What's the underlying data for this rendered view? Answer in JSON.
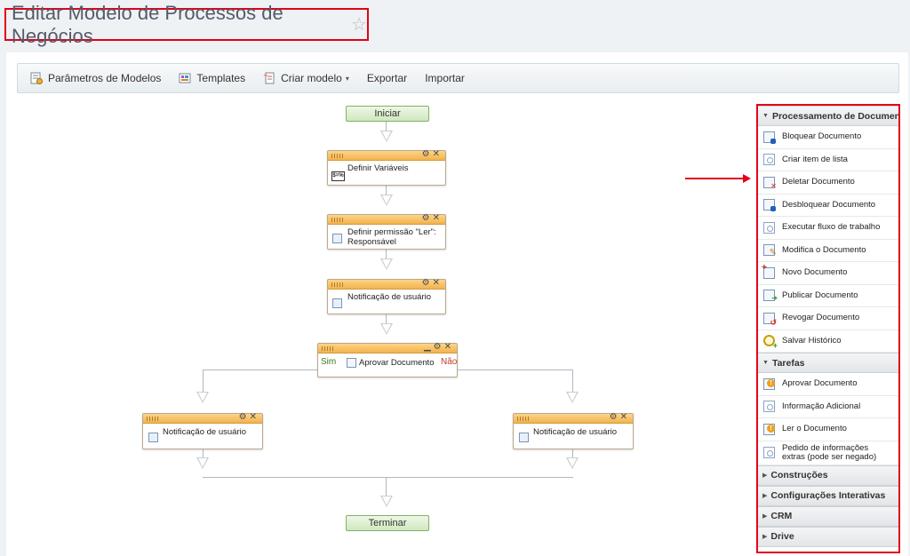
{
  "page": {
    "title": "Editar Modelo de Processos de Negócios",
    "favorite_icon": "star-icon"
  },
  "toolbar": {
    "items": [
      {
        "label": "Parâmetros de Modelos",
        "icon": "settings-icon"
      },
      {
        "label": "Templates",
        "icon": "templates-icon"
      },
      {
        "label": "Criar modelo",
        "icon": "create-model-icon"
      },
      {
        "label": "Exportar"
      },
      {
        "label": "Importar"
      }
    ]
  },
  "diagram": {
    "start_label": "Iniciar",
    "end_label": "Terminar",
    "nodes": {
      "set_variables": "Definir Variáveis",
      "set_variables_icon_text": "$=%",
      "set_permission": "Definir permissão \"Ler\": Responsável",
      "user_notification": "Notificação de usuário",
      "approve_document": "Aprovar Documento",
      "left_notification": "Notificação de usuário",
      "right_notification": "Notificação de usuário"
    },
    "branch_yes": "Sim",
    "branch_no": "Não"
  },
  "panel": {
    "sections": [
      {
        "title": "Processamento de Document",
        "expanded": true,
        "items": [
          {
            "label": "Bloquear Documento",
            "icon": "lock-document-icon"
          },
          {
            "label": "Criar item de lista",
            "icon": "list-item-icon"
          },
          {
            "label": "Deletar Documento",
            "icon": "delete-document-icon"
          },
          {
            "label": "Desbloquear Documento",
            "icon": "unlock-document-icon"
          },
          {
            "label": "Executar fluxo de trabalho",
            "icon": "workflow-icon"
          },
          {
            "label": "Modifica o Documento",
            "icon": "edit-document-icon"
          },
          {
            "label": "Novo Documento",
            "icon": "new-document-icon"
          },
          {
            "label": "Publicar Documento",
            "icon": "publish-document-icon"
          },
          {
            "label": "Revogar Documento",
            "icon": "revoke-document-icon"
          },
          {
            "label": "Salvar Histórico",
            "icon": "save-history-icon"
          }
        ]
      },
      {
        "title": "Tarefas",
        "expanded": true,
        "items": [
          {
            "label": "Aprovar Documento",
            "icon": "approve-document-icon"
          },
          {
            "label": "Informação Adicional",
            "icon": "additional-info-icon"
          },
          {
            "label": "Ler o Documento",
            "icon": "read-document-icon"
          },
          {
            "label": "Pedido de informações extras (pode ser negado)",
            "icon": "extra-info-request-icon"
          }
        ]
      },
      {
        "title": "Construções",
        "expanded": false
      },
      {
        "title": "Configurações Interativas",
        "expanded": false
      },
      {
        "title": "CRM",
        "expanded": false
      },
      {
        "title": "Drive",
        "expanded": false
      }
    ]
  },
  "colors": {
    "highlight": "#e2001a",
    "node_header": "#f3b34d",
    "terminal_fill": "#cfe8bd"
  }
}
